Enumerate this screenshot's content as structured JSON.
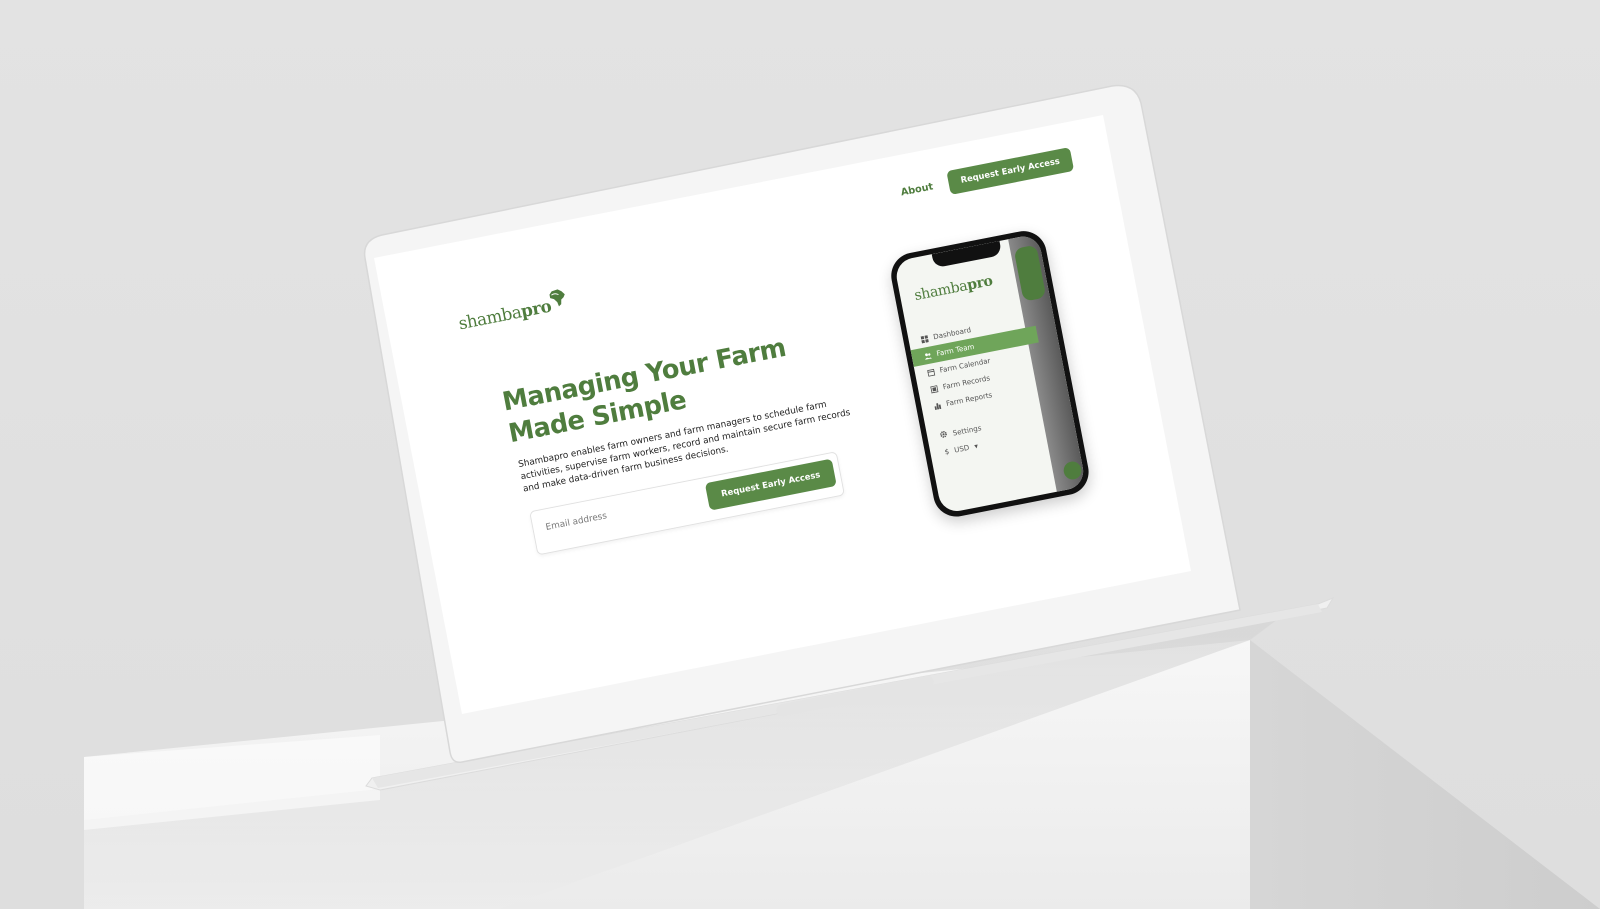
{
  "brand": {
    "name_part1": "shamba",
    "name_part2": "pro",
    "color": "#4f7d3e"
  },
  "nav": {
    "about_label": "About",
    "cta_label": "Request Early Access"
  },
  "hero": {
    "headline": "Managing Your Farm Made Simple",
    "description": "Shambapro enables farm owners and farm managers to schedule farm activities, supervise farm workers, record and maintain secure farm records and make data-driven farm business decisions.",
    "email_placeholder": "Email address",
    "cta_label": "Request Early Access"
  },
  "phone": {
    "menu": [
      {
        "label": "Dashboard",
        "icon": "dashboard-icon",
        "active": false
      },
      {
        "label": "Farm Team",
        "icon": "team-icon",
        "active": true
      },
      {
        "label": "Farm Calendar",
        "icon": "calendar-icon",
        "active": false
      },
      {
        "label": "Farm Records",
        "icon": "records-icon",
        "active": false
      },
      {
        "label": "Farm Reports",
        "icon": "reports-icon",
        "active": false
      }
    ],
    "settings_label": "Settings",
    "currency_symbol": "$",
    "currency_label": "USD"
  },
  "colors": {
    "accent": "#5a8a47",
    "menu_active": "#6fa55a",
    "background": "#e2e2e2"
  }
}
